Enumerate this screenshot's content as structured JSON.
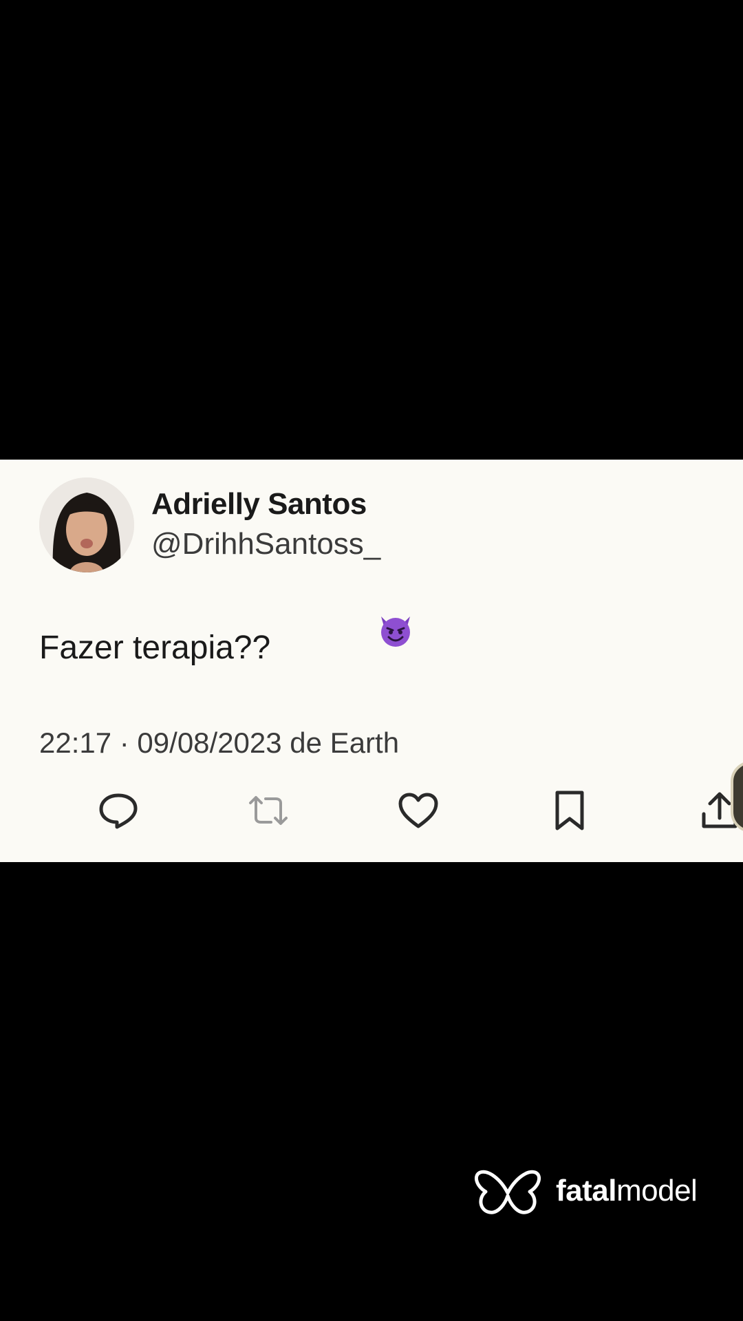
{
  "tweet": {
    "display_name": "Adrielly Santos",
    "handle": "@DrihhSantoss_",
    "text": "Fazer terapia??",
    "sticker_icon": "smiling-devil-emoji",
    "timestamp": "22:17 · 09/08/2023 de Earth",
    "actions": [
      {
        "icon": "reply-icon"
      },
      {
        "icon": "retweet-icon"
      },
      {
        "icon": "like-icon"
      },
      {
        "icon": "bookmark-icon"
      },
      {
        "icon": "share-icon"
      }
    ]
  },
  "watermark": {
    "brand_bold": "fatal",
    "brand_light": "model"
  },
  "colors": {
    "page_background": "#000000",
    "card_background": "#fbfaf5",
    "text_primary": "#1a1a1a",
    "text_secondary": "#3b3b3b",
    "emoji_purple": "#7b3fc0"
  }
}
